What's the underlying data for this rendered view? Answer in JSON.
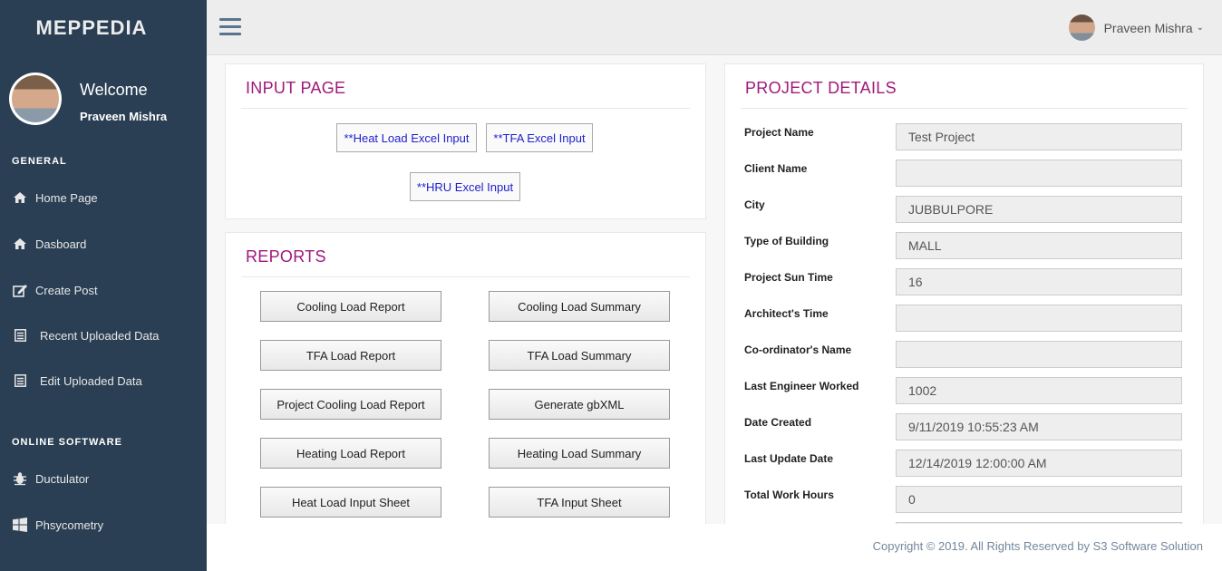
{
  "sidebar": {
    "brand": "MEPPEDIA",
    "welcome": "Welcome",
    "user_name": "Praveen Mishra",
    "general_title": "GENERAL",
    "general_items": [
      {
        "label": "Home Page",
        "icon": "home-icon"
      },
      {
        "label": "Dasboard",
        "icon": "home-icon"
      },
      {
        "label": "Create Post",
        "icon": "edit-icon"
      },
      {
        "label": "Recent Uploaded Data",
        "icon": "list-icon"
      },
      {
        "label": "Edit Uploaded Data",
        "icon": "list-icon"
      }
    ],
    "online_title": "ONLINE SOFTWARE",
    "online_items": [
      {
        "label": "Ductulator",
        "icon": "bug-icon"
      },
      {
        "label": "Phsycometry",
        "icon": "windows-icon"
      }
    ]
  },
  "topbar": {
    "user_name": "Praveen Mishra"
  },
  "input_page": {
    "title": "INPUT PAGE",
    "buttons": [
      "**Heat Load Excel Input",
      "**TFA Excel Input",
      "**HRU Excel Input"
    ]
  },
  "reports": {
    "title": "REPORTS",
    "buttons": [
      "Cooling Load Report",
      "Cooling Load Summary",
      "TFA Load Report",
      "TFA Load Summary",
      "Project Cooling Load Report",
      "Generate gbXML",
      "Heating Load Report",
      "Heating Load Summary",
      "Heat Load Input Sheet",
      "TFA Input Sheet"
    ]
  },
  "project_details": {
    "title": "PROJECT DETAILS",
    "fields": [
      {
        "label": "Project Name",
        "value": "Test Project"
      },
      {
        "label": "Client Name",
        "value": ""
      },
      {
        "label": "City",
        "value": "JUBBULPORE"
      },
      {
        "label": "Type of Building",
        "value": "MALL"
      },
      {
        "label": "Project Sun Time",
        "value": "16"
      },
      {
        "label": "Architect's Time",
        "value": ""
      },
      {
        "label": "Co-ordinator's Name",
        "value": ""
      },
      {
        "label": "Last Engineer Worked",
        "value": "1002"
      },
      {
        "label": "Date Created",
        "value": "9/11/2019 10:55:23 AM"
      },
      {
        "label": "Last Update Date",
        "value": "12/14/2019 12:00:00 AM"
      },
      {
        "label": "Total Work Hours",
        "value": "0"
      }
    ]
  },
  "footer": {
    "copyright": "Copyright © 2019. All Rights Reserved by S3 Software Solution"
  },
  "colors": {
    "sidebar_bg": "#2a3f54",
    "accent_title": "#a0197a",
    "link_text": "#2020cc"
  }
}
